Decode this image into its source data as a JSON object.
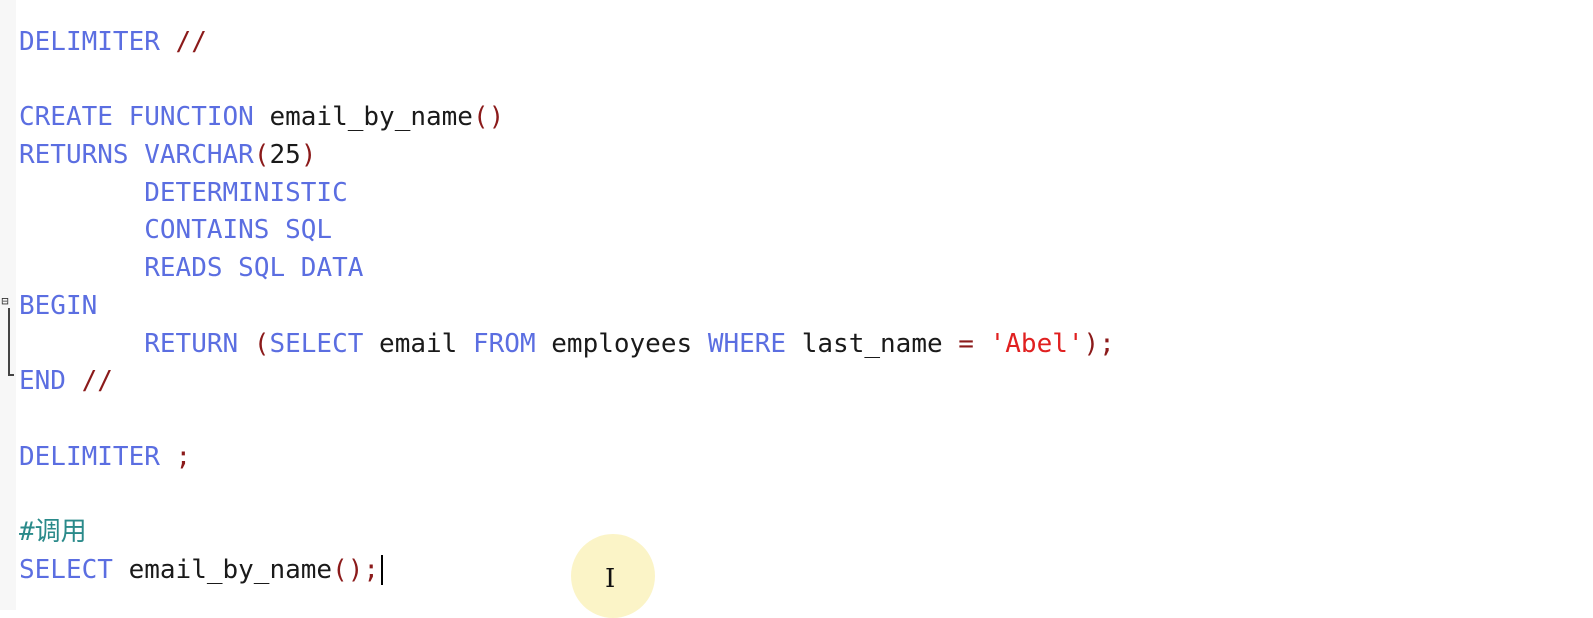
{
  "editor": {
    "lines": [
      [
        {
          "t": "DELIMITER",
          "c": "kw"
        },
        {
          "t": " "
        },
        {
          "t": "//",
          "c": "op"
        }
      ],
      [],
      [
        {
          "t": "CREATE",
          "c": "kw"
        },
        {
          "t": " "
        },
        {
          "t": "FUNCTION",
          "c": "kw"
        },
        {
          "t": " "
        },
        {
          "t": "email_by_name",
          "c": "id"
        },
        {
          "t": "()",
          "c": "op"
        }
      ],
      [
        {
          "t": "RETURNS",
          "c": "kw"
        },
        {
          "t": " "
        },
        {
          "t": "VARCHAR",
          "c": "kw"
        },
        {
          "t": "(",
          "c": "op"
        },
        {
          "t": "25",
          "c": "num"
        },
        {
          "t": ")",
          "c": "op"
        }
      ],
      [
        {
          "t": "        "
        },
        {
          "t": "DETERMINISTIC",
          "c": "kw"
        }
      ],
      [
        {
          "t": "        "
        },
        {
          "t": "CONTAINS",
          "c": "kw"
        },
        {
          "t": " "
        },
        {
          "t": "SQL",
          "c": "kw"
        }
      ],
      [
        {
          "t": "        "
        },
        {
          "t": "READS",
          "c": "kw"
        },
        {
          "t": " "
        },
        {
          "t": "SQL",
          "c": "kw"
        },
        {
          "t": " "
        },
        {
          "t": "DATA",
          "c": "kw"
        }
      ],
      [
        {
          "t": "BEGIN",
          "c": "kw"
        }
      ],
      [
        {
          "t": "        "
        },
        {
          "t": "RETURN",
          "c": "kw"
        },
        {
          "t": " "
        },
        {
          "t": "(",
          "c": "op"
        },
        {
          "t": "SELECT",
          "c": "kw"
        },
        {
          "t": " "
        },
        {
          "t": "email",
          "c": "id"
        },
        {
          "t": " "
        },
        {
          "t": "FROM",
          "c": "kw"
        },
        {
          "t": " "
        },
        {
          "t": "employees",
          "c": "id"
        },
        {
          "t": " "
        },
        {
          "t": "WHERE",
          "c": "kw"
        },
        {
          "t": " "
        },
        {
          "t": "last_name",
          "c": "id"
        },
        {
          "t": " "
        },
        {
          "t": "=",
          "c": "op"
        },
        {
          "t": " "
        },
        {
          "t": "'Abel'",
          "c": "str"
        },
        {
          "t": ");",
          "c": "op"
        }
      ],
      [
        {
          "t": "END",
          "c": "kw"
        },
        {
          "t": " "
        },
        {
          "t": "//",
          "c": "op"
        }
      ],
      [],
      [
        {
          "t": "DELIMITER",
          "c": "kw"
        },
        {
          "t": " "
        },
        {
          "t": ";",
          "c": "op"
        }
      ],
      [],
      [
        {
          "t": "#调用",
          "c": "cmt"
        }
      ],
      [
        {
          "t": "SELECT",
          "c": "kw"
        },
        {
          "t": " "
        },
        {
          "t": "email_by_name",
          "c": "id"
        },
        {
          "t": "();",
          "c": "op"
        }
      ]
    ],
    "fold_marker": "⊟",
    "mouse_cursor": "I"
  }
}
